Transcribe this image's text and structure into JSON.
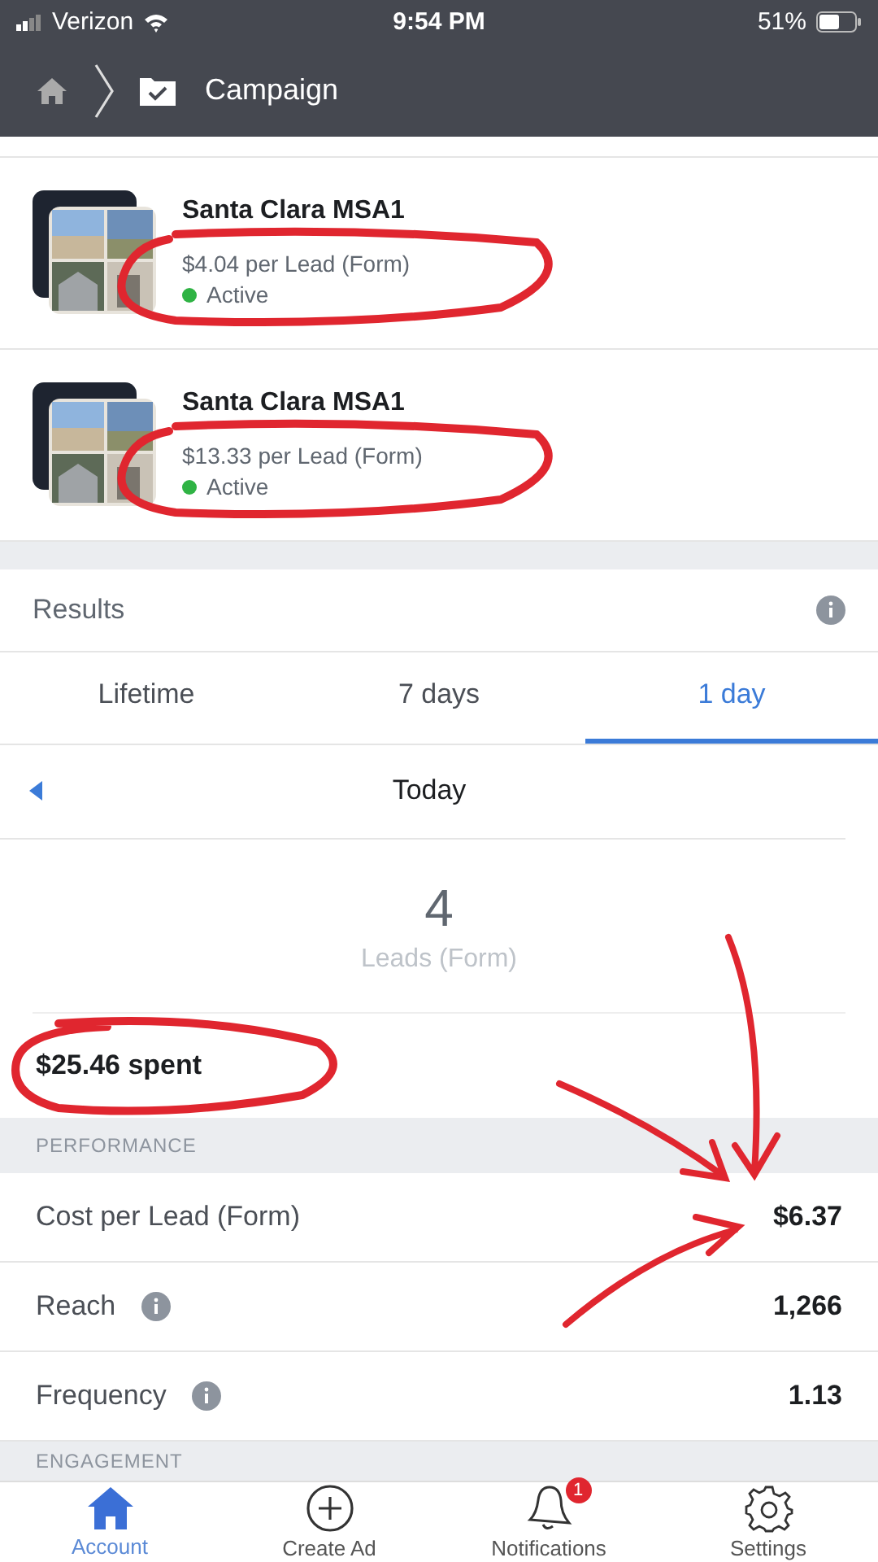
{
  "status_bar": {
    "carrier": "Verizon",
    "time": "9:54 PM",
    "battery": "51%"
  },
  "nav": {
    "title": "Campaign"
  },
  "campaigns": [
    {
      "name": "Santa Clara MSA1",
      "cost": "$4.04 per Lead (Form)",
      "status": "Active",
      "color": "#2fb344"
    },
    {
      "name": "Santa Clara MSA1",
      "cost": "$13.33 per Lead (Form)",
      "status": "Active",
      "color": "#2fb344"
    }
  ],
  "results": {
    "title": "Results",
    "tabs": [
      {
        "label": "Lifetime",
        "selected": false
      },
      {
        "label": "7 days",
        "selected": false
      },
      {
        "label": "1 day",
        "selected": true
      }
    ],
    "period": "Today",
    "value": "4",
    "metric": "Leads (Form)",
    "spent": "$25.46 spent"
  },
  "performance": {
    "heading": "PERFORMANCE",
    "rows": [
      {
        "label": "Cost per Lead (Form)",
        "value": "$6.37",
        "info": false
      },
      {
        "label": "Reach",
        "value": "1,266",
        "info": true
      },
      {
        "label": "Frequency",
        "value": "1.13",
        "info": true
      }
    ]
  },
  "engagement": {
    "heading": "ENGAGEMENT"
  },
  "tab_bar": [
    {
      "label": "Account",
      "kind": "home",
      "selected": true
    },
    {
      "label": "Create Ad",
      "kind": "plus",
      "selected": false
    },
    {
      "label": "Notifications",
      "kind": "bell",
      "selected": false,
      "badge": "1"
    },
    {
      "label": "Settings",
      "kind": "gear",
      "selected": false
    }
  ]
}
